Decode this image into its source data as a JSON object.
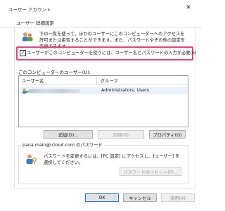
{
  "window": {
    "title": "ユーザー アカウント",
    "close_glyph": "✕"
  },
  "tabs": [
    {
      "label": "ユーザー"
    },
    {
      "label": "詳細設定"
    }
  ],
  "description": "下の一覧を使って、ほかのユーザーにこのコンピューターへのアクセスを許可または拒否することができます。また、パスワードやその他の設定を変更できます。",
  "checkbox": {
    "checked": true,
    "mark": "✓",
    "label": "ユーザーがこのコンピューターを使うには、ユーザー名とパスワードの入力が必要(E)"
  },
  "users_section": {
    "label": "このコンピューターのユーザー(U):",
    "columns": [
      "ユーザー名",
      "グループ"
    ],
    "rows": [
      {
        "group": "Administrators; Users"
      }
    ]
  },
  "buttons": {
    "add": "追加(D)...",
    "remove": "削除(R)",
    "properties": "プロパティ(O)"
  },
  "password_group": {
    "title": "pana.main@icloud.com のパスワード",
    "text": "パスワードを変更するには、[PC 設定] にアクセスし、[ユーザー] を選択してください。",
    "reset": "パスワードのリセット(P)..."
  },
  "footer": {
    "ok": "OK",
    "cancel": "キャンセル",
    "apply": "適用(A)"
  },
  "colors": {
    "highlight": "#e8407a",
    "ok_border": "#2b7bd8"
  }
}
